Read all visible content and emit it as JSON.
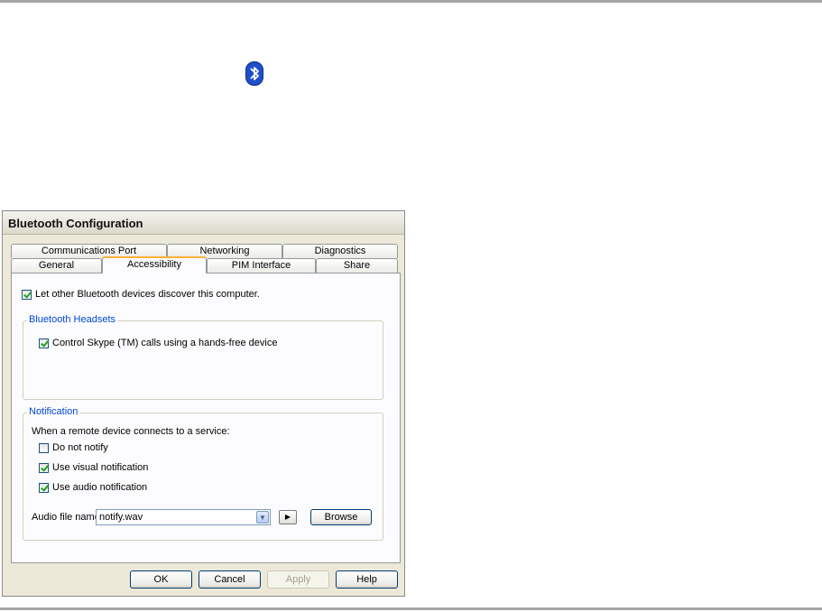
{
  "dialog": {
    "title": "Bluetooth Configuration",
    "tabs_row_back": [
      "Communications Port",
      "Networking",
      "Diagnostics"
    ],
    "tabs_row_front": [
      "General",
      "Accessibility",
      "PIM Interface",
      "Share"
    ],
    "active_tab": "Accessibility"
  },
  "panel": {
    "discover": {
      "label": "Let other Bluetooth devices discover this computer.",
      "checked": true
    },
    "headsets": {
      "legend": "Bluetooth Headsets",
      "skype": {
        "label": "Control Skype (TM) calls using a hands-free device",
        "checked": true
      }
    },
    "notification": {
      "legend": "Notification",
      "intro": "When a remote device connects to a service:",
      "do_not_notify": {
        "label": "Do not notify",
        "checked": false
      },
      "visual": {
        "label": "Use visual notification",
        "checked": true
      },
      "audio": {
        "label": "Use audio notification",
        "checked": true
      },
      "audio_file_label": "Audio file name:",
      "audio_file_value": "notify.wav",
      "browse_label": "Browse"
    }
  },
  "buttons": {
    "ok": "OK",
    "cancel": "Cancel",
    "apply": "Apply",
    "help": "Help"
  },
  "colors": {
    "accent_tab": "#ffb23d",
    "legend": "#0046d5",
    "bluetooth": "#1f4fc9"
  },
  "icons": {
    "logo": "bluetooth-icon",
    "combo_arrow": "chevron-down-icon",
    "play": "play-icon"
  }
}
